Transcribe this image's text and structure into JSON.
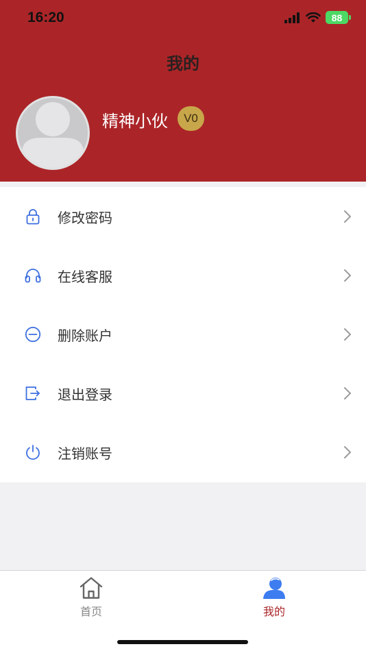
{
  "status_bar": {
    "time": "16:20",
    "battery": "88"
  },
  "header": {
    "title": "我的"
  },
  "profile": {
    "username": "精神小伙",
    "level": "V0"
  },
  "menu": [
    {
      "label": "修改密码",
      "icon": "lock-icon"
    },
    {
      "label": "在线客服",
      "icon": "headset-icon"
    },
    {
      "label": "删除账户",
      "icon": "minus-circle-icon"
    },
    {
      "label": "退出登录",
      "icon": "logout-icon"
    },
    {
      "label": "注销账号",
      "icon": "power-icon"
    }
  ],
  "tabbar": {
    "items": [
      {
        "label": "首页",
        "icon": "home-icon",
        "active": false
      },
      {
        "label": "我的",
        "icon": "user-icon",
        "active": true
      }
    ]
  },
  "colors": {
    "header_bg": "#ab2528",
    "icon_blue": "#3d6fe0",
    "badge_gold": "#c8a64a",
    "active_tab": "#ab2528",
    "inactive_tab": "#888888"
  }
}
